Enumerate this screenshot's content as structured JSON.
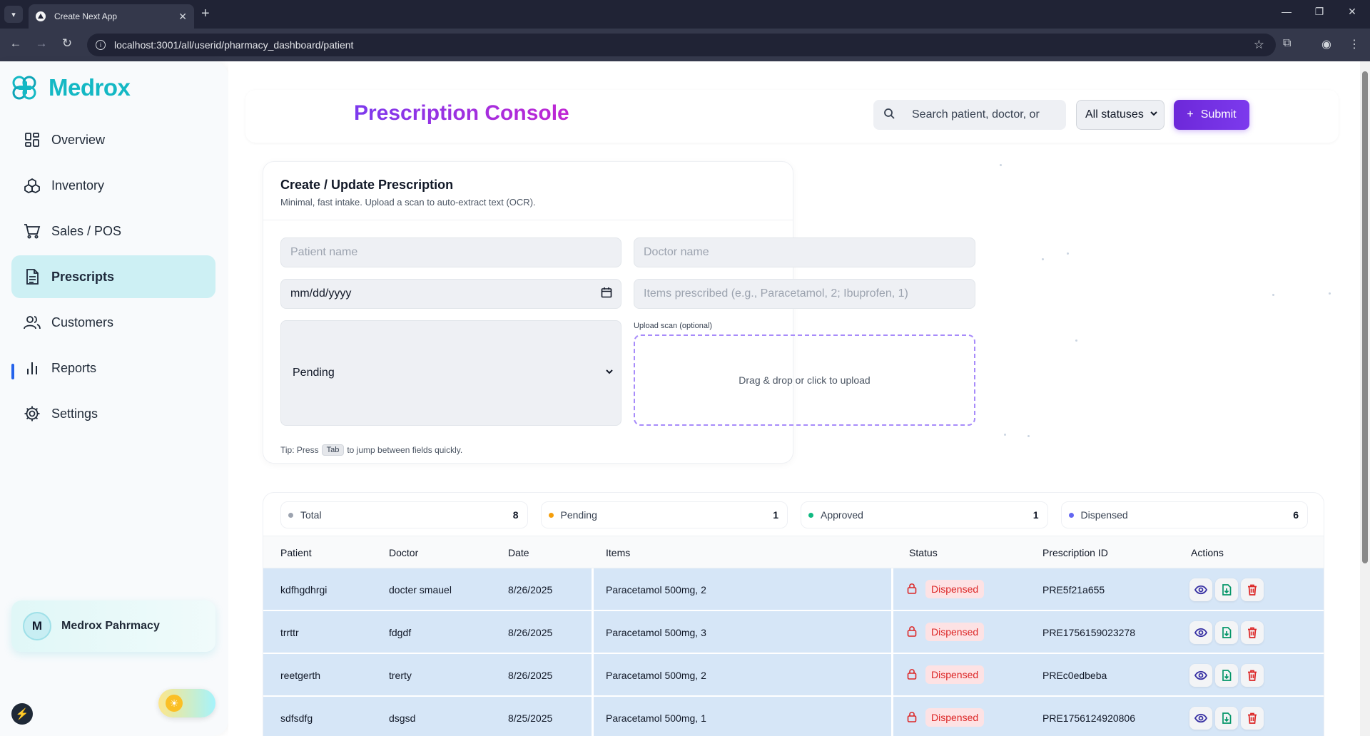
{
  "browser": {
    "tab_title": "Create Next App",
    "url": "localhost:3001/all/userid/pharmacy_dashboard/patient"
  },
  "brand": {
    "name": "Medrox",
    "color": "#14b8c4"
  },
  "sidebar": {
    "items": [
      {
        "label": "Overview",
        "icon": "grid-icon"
      },
      {
        "label": "Inventory",
        "icon": "boxes-icon"
      },
      {
        "label": "Sales / POS",
        "icon": "cart-icon"
      },
      {
        "label": "Prescripts",
        "icon": "document-icon",
        "active": true
      },
      {
        "label": "Customers",
        "icon": "users-icon"
      },
      {
        "label": "Reports",
        "icon": "bar-chart-icon"
      },
      {
        "label": "Settings",
        "icon": "gear-icon"
      }
    ],
    "profile": {
      "initial": "M",
      "name": "Medrox Pahrmacy"
    }
  },
  "header": {
    "title": "Prescription Console",
    "search_placeholder": "Search patient, doctor, or",
    "status_filter": "All statuses",
    "submit_label": "Submit"
  },
  "form": {
    "title": "Create / Update Prescription",
    "subtitle": "Minimal, fast intake. Upload a scan to auto-extract text (OCR).",
    "patient_placeholder": "Patient name",
    "doctor_placeholder": "Doctor name",
    "date_value": "mm/dd/yyyy",
    "items_placeholder": "Items prescribed (e.g., Paracetamol, 2; Ibuprofen, 1)",
    "status_value": "Pending",
    "upload_label": "Upload scan (optional)",
    "upload_text": "Drag & drop or click to upload",
    "tip_prefix": "Tip: Press",
    "tip_key": "Tab",
    "tip_suffix": "to jump between fields quickly."
  },
  "stats": [
    {
      "label": "Total",
      "count": "8",
      "color": "#9ca3af"
    },
    {
      "label": "Pending",
      "count": "1",
      "color": "#f59e0b"
    },
    {
      "label": "Approved",
      "count": "1",
      "color": "#10b981"
    },
    {
      "label": "Dispensed",
      "count": "6",
      "color": "#6366f1"
    }
  ],
  "table": {
    "columns": [
      "Patient",
      "Doctor",
      "Date",
      "Items",
      "Status",
      "Prescription ID",
      "Actions"
    ],
    "rows": [
      {
        "patient": "kdfhgdhrgi",
        "doctor": "docter smauel",
        "date": "8/26/2025",
        "items": "Paracetamol 500mg, 2",
        "status": "Dispensed",
        "id": "PRE5f21a655"
      },
      {
        "patient": "trrttr",
        "doctor": "fdgdf",
        "date": "8/26/2025",
        "items": "Paracetamol 500mg, 3",
        "status": "Dispensed",
        "id": "PRE1756159023278"
      },
      {
        "patient": "reetgerth",
        "doctor": "trerty",
        "date": "8/26/2025",
        "items": "Paracetamol 500mg, 2",
        "status": "Dispensed",
        "id": "PREc0edbeba"
      },
      {
        "patient": "sdfsdfg",
        "doctor": "dsgsd",
        "date": "8/25/2025",
        "items": "Paracetamol 500mg, 1",
        "status": "Dispensed",
        "id": "PRE1756124920806"
      }
    ]
  }
}
